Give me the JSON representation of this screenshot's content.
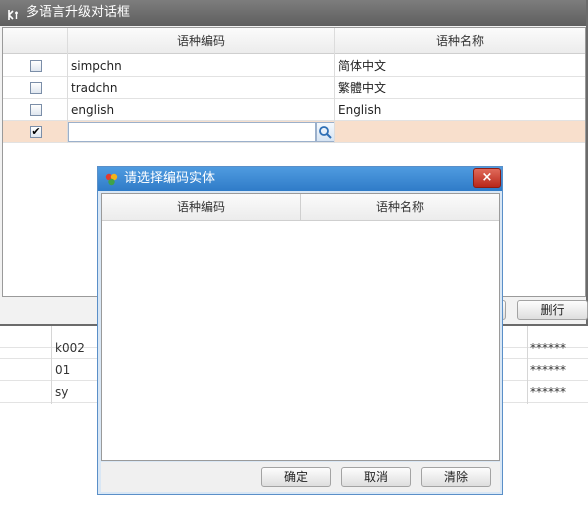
{
  "main_dialog": {
    "title": "多语言升级对话框",
    "columns": [
      "语种编码",
      "语种名称"
    ],
    "rows": [
      {
        "code": "simpchn",
        "name": "简体中文",
        "checked": false
      },
      {
        "code": "tradchn",
        "name": "繁體中文",
        "checked": false
      },
      {
        "code": "english",
        "name": "English",
        "checked": false
      }
    ],
    "edit_row": {
      "checked_mark": "✔",
      "code": "",
      "name": ""
    },
    "delete_row_label": "删行"
  },
  "background_table": {
    "rows": [
      {
        "code": "",
        "value": ""
      },
      {
        "code": "k002",
        "value": "******"
      },
      {
        "code": "01",
        "value": "******"
      },
      {
        "code": "sy",
        "value": "******"
      }
    ]
  },
  "select_dialog": {
    "title": "请选择编码实体",
    "columns": [
      "语种编码",
      "语种名称"
    ],
    "close_label": "×",
    "ok_label": "确定",
    "cancel_label": "取消",
    "clear_label": "清除"
  },
  "colors": {
    "main_titlebar": "#6b6b6b",
    "select_titlebar": "#3a86d1",
    "selected_row": "#f8dfcc",
    "close_button": "#c9392b"
  },
  "icons": {
    "main_title_icon": "app-icon",
    "select_title_icon": "app-icon",
    "search": "search-icon"
  }
}
